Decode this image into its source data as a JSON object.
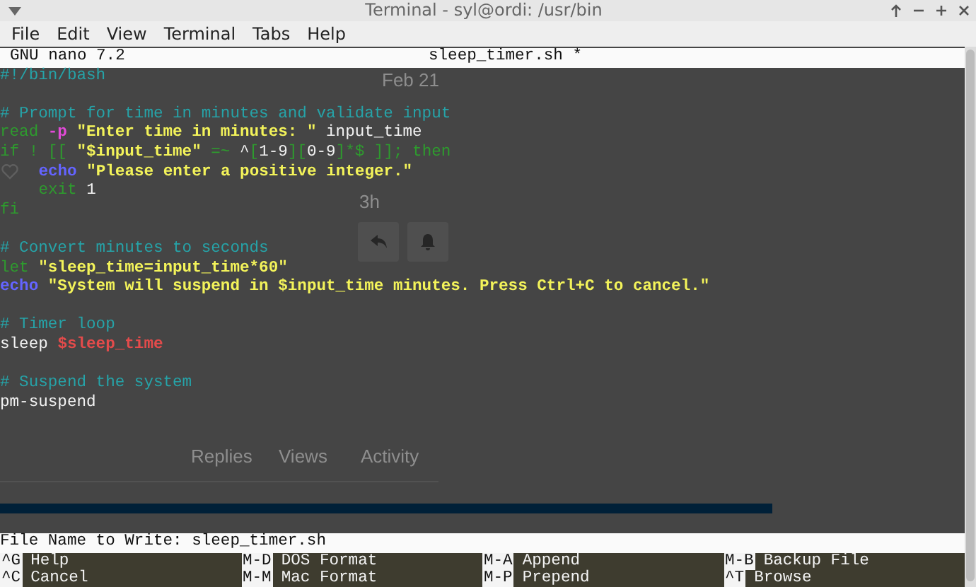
{
  "window": {
    "title": "Terminal - syl@ordi: /usr/bin"
  },
  "menu": [
    "File",
    "Edit",
    "View",
    "Terminal",
    "Tabs",
    "Help"
  ],
  "nano": {
    "version": "GNU nano 7.2",
    "filename": "sleep_timer.sh *",
    "lines": [
      {
        "kind": "code",
        "indent": false,
        "tokens": [
          {
            "kind": "comment",
            "text": "#!/bin/bash"
          }
        ]
      },
      {
        "kind": "blank"
      },
      {
        "kind": "code",
        "indent": false,
        "tokens": [
          {
            "kind": "comment",
            "text": "# Prompt for time in minutes and validate input"
          }
        ]
      },
      {
        "kind": "code",
        "indent": false,
        "tokens": [
          {
            "kind": "keyword",
            "text": "read "
          },
          {
            "kind": "flag",
            "text": "-p"
          },
          {
            "kind": "string",
            "text": " \"Enter time in minutes: \""
          },
          {
            "kind": "plain",
            "text": " input_time"
          }
        ]
      },
      {
        "kind": "code",
        "indent": false,
        "tokens": [
          {
            "kind": "keyword",
            "text": "if ! [[ "
          },
          {
            "kind": "string",
            "text": "\"$input_time\""
          },
          {
            "kind": "keyword",
            "text": " =~ "
          },
          {
            "kind": "plain",
            "text": "^"
          },
          {
            "kind": "keyword",
            "text": "["
          },
          {
            "kind": "plain",
            "text": "1-9"
          },
          {
            "kind": "keyword",
            "text": "]["
          },
          {
            "kind": "plain",
            "text": "0-9"
          },
          {
            "kind": "keyword",
            "text": "]*$ ]]; then"
          }
        ]
      },
      {
        "kind": "code",
        "indent": true,
        "tokens": [
          {
            "kind": "builtin",
            "text": "echo"
          },
          {
            "kind": "string",
            "text": " \"Please enter a positive integer.\""
          }
        ]
      },
      {
        "kind": "code",
        "indent": true,
        "tokens": [
          {
            "kind": "keyword",
            "text": "exit"
          },
          {
            "kind": "plain",
            "text": " 1"
          }
        ]
      },
      {
        "kind": "code",
        "indent": false,
        "tokens": [
          {
            "kind": "keyword",
            "text": "fi"
          }
        ]
      },
      {
        "kind": "blank"
      },
      {
        "kind": "code",
        "indent": false,
        "tokens": [
          {
            "kind": "comment",
            "text": "# Convert minutes to seconds"
          }
        ]
      },
      {
        "kind": "code",
        "indent": false,
        "tokens": [
          {
            "kind": "keyword",
            "text": "let"
          },
          {
            "kind": "string",
            "text": " \"sleep_time=input_time*60\""
          }
        ]
      },
      {
        "kind": "code",
        "indent": false,
        "tokens": [
          {
            "kind": "builtin",
            "text": "echo"
          },
          {
            "kind": "string",
            "text": " \"System will suspend in $input_time minutes. Press Ctrl+C to cancel.\""
          }
        ]
      },
      {
        "kind": "blank"
      },
      {
        "kind": "code",
        "indent": false,
        "tokens": [
          {
            "kind": "comment",
            "text": "# Timer loop"
          }
        ]
      },
      {
        "kind": "code",
        "indent": false,
        "tokens": [
          {
            "kind": "plain",
            "text": "sleep "
          },
          {
            "kind": "variable",
            "text": "$sleep_time"
          }
        ]
      },
      {
        "kind": "blank"
      },
      {
        "kind": "code",
        "indent": false,
        "tokens": [
          {
            "kind": "comment",
            "text": "# Suspend the system"
          }
        ]
      },
      {
        "kind": "code",
        "indent": false,
        "tokens": [
          {
            "kind": "plain",
            "text": "pm-suspend"
          }
        ]
      }
    ],
    "prompt": "File Name to Write: sleep_timer.sh",
    "shortcuts": [
      {
        "key": "^G",
        "label": "Help"
      },
      {
        "key": "M-D",
        "label": "DOS Format"
      },
      {
        "key": "M-A",
        "label": "Append"
      },
      {
        "key": "M-B",
        "label": "Backup File"
      },
      {
        "key": "^C",
        "label": "Cancel"
      },
      {
        "key": "M-M",
        "label": "Mac Format"
      },
      {
        "key": "M-P",
        "label": "Prepend"
      },
      {
        "key": "^T",
        "label": "Browse"
      }
    ]
  },
  "background_page": {
    "date": "Feb 21",
    "age": "3h",
    "stats": [
      "Replies",
      "Views",
      "Activity"
    ],
    "progress": {
      "level": 0.8
    }
  }
}
